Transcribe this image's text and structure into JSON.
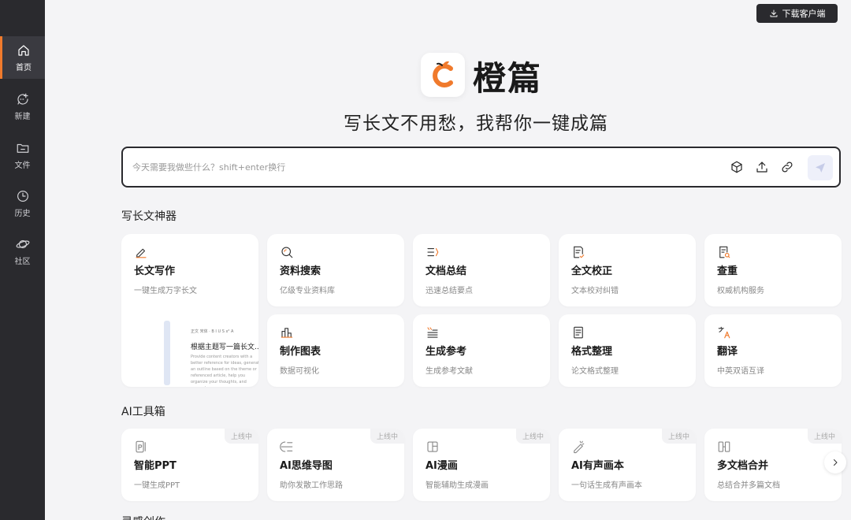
{
  "sidebar": {
    "items": [
      {
        "label": "首页",
        "icon": "home-icon"
      },
      {
        "label": "新建",
        "icon": "new-chat-icon"
      },
      {
        "label": "文件",
        "icon": "folder-icon"
      },
      {
        "label": "历史",
        "icon": "clock-icon"
      },
      {
        "label": "社区",
        "icon": "planet-icon"
      }
    ],
    "active_index": 0
  },
  "header": {
    "download_label": "下载客户端"
  },
  "brand": {
    "name": "橙篇",
    "slogan": "写长文不用愁，我帮你一键成篇",
    "accent_color": "#f07a2c"
  },
  "search": {
    "placeholder": "今天需要我做些什么？shift+enter换行",
    "value": ""
  },
  "sections": {
    "writing_title": "写长文神器",
    "toolbox_title": "AI工具箱",
    "next_title": "灵感创作"
  },
  "writing_tools": [
    {
      "title": "长文写作",
      "desc": "一键生成万字长文",
      "icon": "pen-icon"
    },
    {
      "title": "资料搜索",
      "desc": "亿级专业资料库",
      "icon": "search-icon"
    },
    {
      "title": "文档总结",
      "desc": "迅速总结要点",
      "icon": "list-summary-icon"
    },
    {
      "title": "全文校正",
      "desc": "文本校对纠错",
      "icon": "doc-check-icon"
    },
    {
      "title": "查重",
      "desc": "权威机构服务",
      "icon": "doc-search-icon"
    },
    {
      "title": "制作图表",
      "desc": "数据可视化",
      "icon": "chart-icon"
    },
    {
      "title": "生成参考",
      "desc": "生成参考文献",
      "icon": "quote-icon"
    },
    {
      "title": "格式整理",
      "desc": "论文格式整理",
      "icon": "format-icon"
    },
    {
      "title": "翻译",
      "desc": "中英双语互译",
      "icon": "translate-icon"
    }
  ],
  "preview": {
    "toolbar": "正文 宋体 · B I U S x² A",
    "title": "根据主题写一篇长文...",
    "text": "Provide content creators with a better reference for ideas, generate an outline based on the theme or referenced article, help you organize your thoughts, and generate a"
  },
  "ai_tools": [
    {
      "title": "智能PPT",
      "desc": "一键生成PPT",
      "badge": "上线中",
      "icon": "ppt-icon"
    },
    {
      "title": "AI思维导图",
      "desc": "助你发散工作思路",
      "badge": "上线中",
      "icon": "mindmap-icon"
    },
    {
      "title": "AI漫画",
      "desc": "智能辅助生成漫画",
      "badge": "上线中",
      "icon": "comic-icon"
    },
    {
      "title": "AI有声画本",
      "desc": "一句话生成有声画本",
      "badge": "上线中",
      "icon": "audio-book-icon"
    },
    {
      "title": "多文档合并",
      "desc": "总结合并多篇文档",
      "badge": "上线中",
      "icon": "merge-icon"
    }
  ]
}
